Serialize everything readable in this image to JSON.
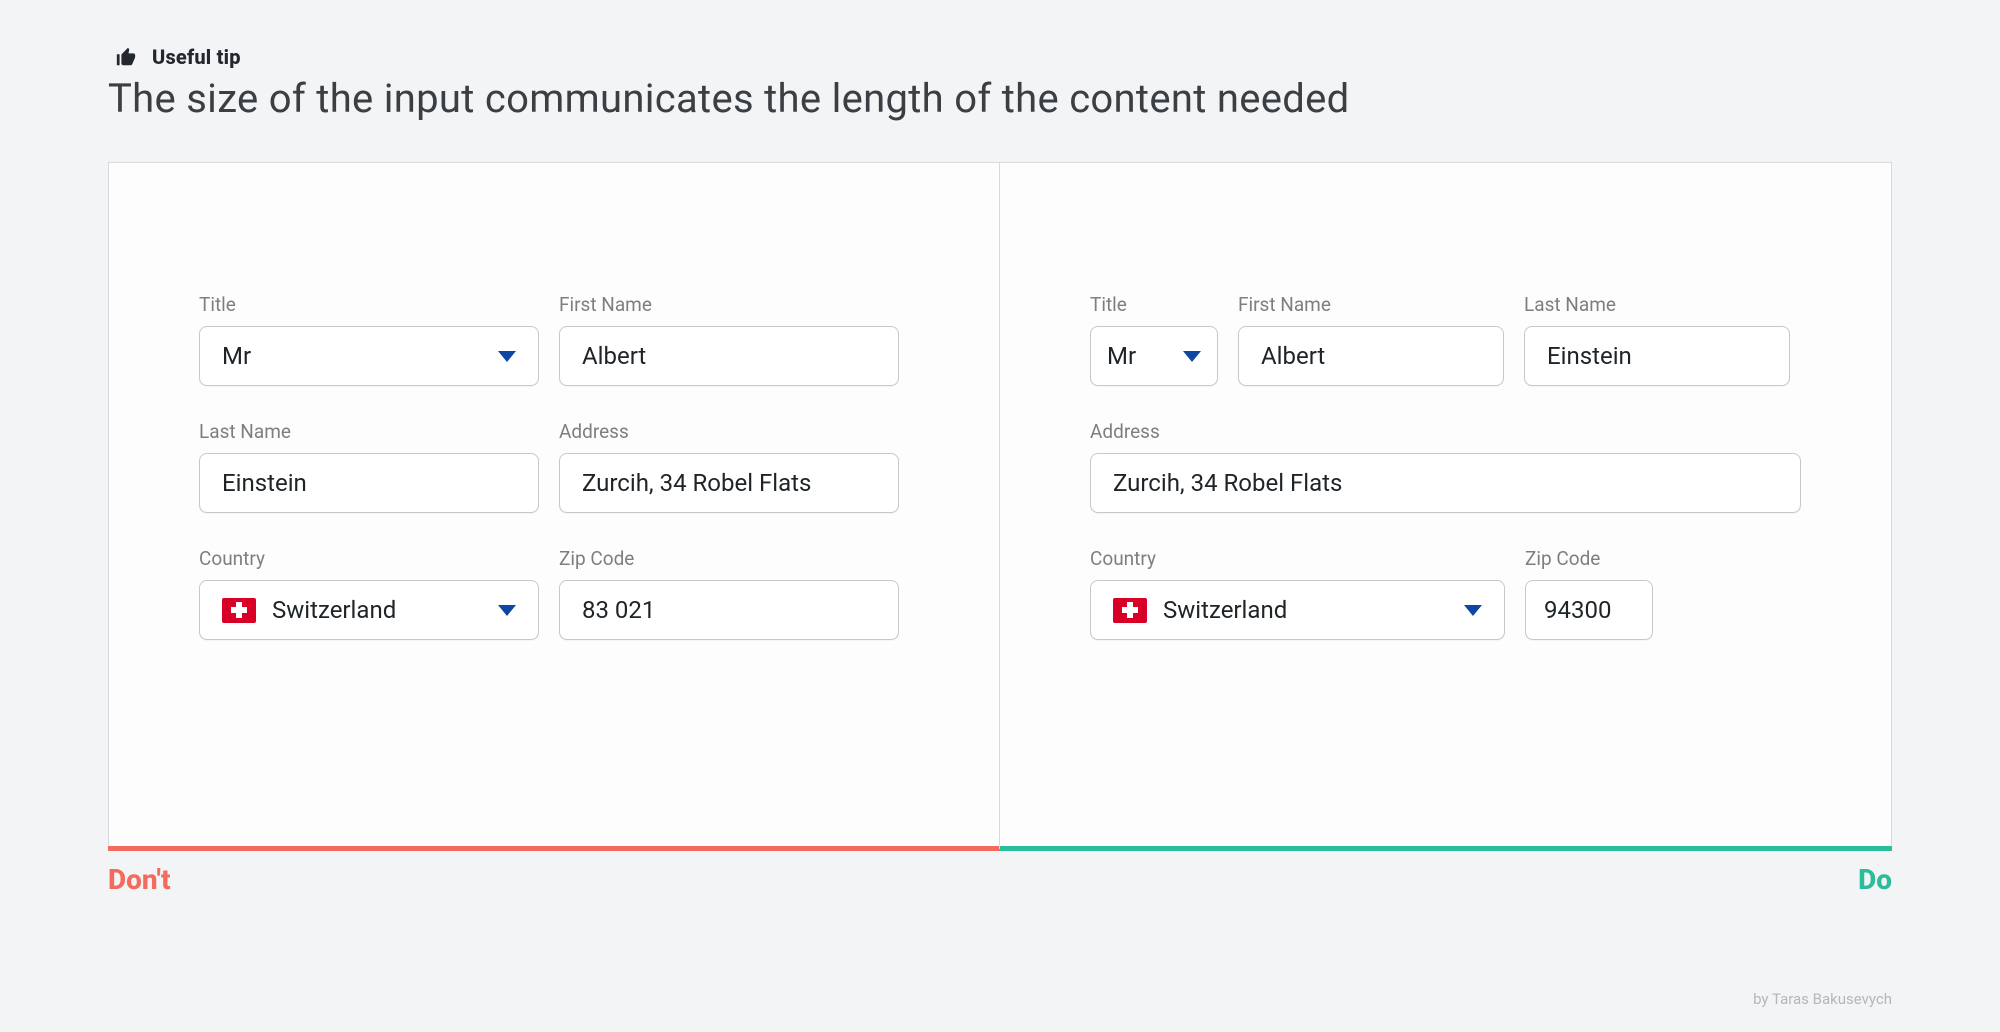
{
  "tip": {
    "label": "Useful tip",
    "headline": "The size of the input communicates the length of the content needed"
  },
  "dont": {
    "label": "Don't",
    "title": {
      "label": "Title",
      "value": "Mr"
    },
    "first_name": {
      "label": "First Name",
      "value": "Albert"
    },
    "last_name": {
      "label": "Last Name",
      "value": "Einstein"
    },
    "address": {
      "label": "Address",
      "value": "Zurcih, 34 Robel Flats"
    },
    "country": {
      "label": "Country",
      "value": "Switzerland"
    },
    "zip": {
      "label": "Zip Code",
      "value": "83 021"
    }
  },
  "do": {
    "label": "Do",
    "title": {
      "label": "Title",
      "value": "Mr"
    },
    "first_name": {
      "label": "First Name",
      "value": "Albert"
    },
    "last_name": {
      "label": "Last Name",
      "value": "Einstein"
    },
    "address": {
      "label": "Address",
      "value": "Zurcih, 34 Robel Flats"
    },
    "country": {
      "label": "Country",
      "value": "Switzerland"
    },
    "zip": {
      "label": "Zip Code",
      "value": "94300"
    }
  },
  "byline": "by Taras Bakusevych"
}
